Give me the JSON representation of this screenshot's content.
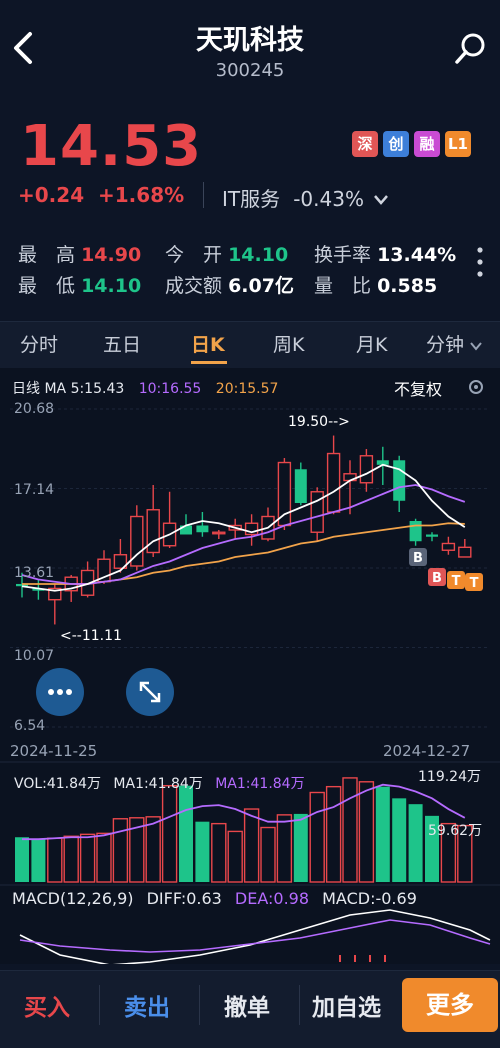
{
  "header": {
    "title": "天玑科技",
    "code": "300245"
  },
  "quote": {
    "price": "14.53",
    "change": "+0.24",
    "change_pct": "+1.68%",
    "sector_name": "IT服务",
    "sector_change": "-0.43%",
    "badges": [
      {
        "label": "深",
        "color": "#e05656"
      },
      {
        "label": "创",
        "color": "#3d7fd9"
      },
      {
        "label": "融",
        "color": "#c94bd3"
      },
      {
        "label": "L1",
        "color": "#f08a2c"
      }
    ]
  },
  "stats": {
    "high_label": "最　高",
    "high": "14.90",
    "open_label": "今　开",
    "open": "14.10",
    "turnover_label": "换手率",
    "turnover": "13.44%",
    "low_label": "最　低",
    "low": "14.10",
    "amount_label": "成交额",
    "amount": "6.07亿",
    "volratio_label": "量　比",
    "volratio": "0.585"
  },
  "tabs": [
    "分时",
    "五日",
    "日K",
    "周K",
    "月K",
    "分钟"
  ],
  "active_tab": "日K",
  "chart_data": {
    "type": "candlestick",
    "legend": {
      "label": "日线 MA",
      "ma5": "5:15.43",
      "ma10": "10:16.55",
      "ma20": "20:15.57"
    },
    "adjust_label": "不复权",
    "y_ticks": [
      "20.68",
      "17.14",
      "13.61",
      "10.07",
      "6.54"
    ],
    "ylim": [
      6.54,
      20.68
    ],
    "start_date": "2024-11-25",
    "end_date": "2024-12-27",
    "annotation_high": "19.50-->",
    "annotation_low": "<--11.11",
    "markers": [
      "B",
      "B",
      "T",
      "T"
    ],
    "candles": [
      {
        "o": 12.9,
        "h": 13.4,
        "l": 12.3,
        "c": 12.8
      },
      {
        "o": 12.7,
        "h": 13.1,
        "l": 12.2,
        "c": 12.6
      },
      {
        "o": 12.2,
        "h": 12.9,
        "l": 11.1,
        "c": 12.7
      },
      {
        "o": 12.6,
        "h": 13.3,
        "l": 12.1,
        "c": 13.2
      },
      {
        "o": 12.4,
        "h": 13.9,
        "l": 12.3,
        "c": 13.5
      },
      {
        "o": 13.0,
        "h": 14.4,
        "l": 12.9,
        "c": 14.0
      },
      {
        "o": 13.6,
        "h": 14.9,
        "l": 13.4,
        "c": 14.2
      },
      {
        "o": 13.7,
        "h": 16.4,
        "l": 13.5,
        "c": 15.9
      },
      {
        "o": 14.3,
        "h": 17.3,
        "l": 14.1,
        "c": 16.2
      },
      {
        "o": 14.6,
        "h": 17.0,
        "l": 14.5,
        "c": 15.6
      },
      {
        "o": 15.5,
        "h": 16.0,
        "l": 15.2,
        "c": 15.1
      },
      {
        "o": 15.5,
        "h": 16.1,
        "l": 15.0,
        "c": 15.2
      },
      {
        "o": 15.2,
        "h": 15.3,
        "l": 14.9,
        "c": 15.2
      },
      {
        "o": 15.3,
        "h": 15.8,
        "l": 14.9,
        "c": 15.5
      },
      {
        "o": 15.1,
        "h": 16.0,
        "l": 14.6,
        "c": 15.6
      },
      {
        "o": 14.9,
        "h": 16.3,
        "l": 14.8,
        "c": 15.9
      },
      {
        "o": 15.5,
        "h": 18.5,
        "l": 15.3,
        "c": 18.3
      },
      {
        "o": 18.0,
        "h": 18.3,
        "l": 16.4,
        "c": 16.5
      },
      {
        "o": 15.2,
        "h": 17.2,
        "l": 14.8,
        "c": 17.0
      },
      {
        "o": 16.1,
        "h": 19.5,
        "l": 16.0,
        "c": 18.7
      },
      {
        "o": 17.5,
        "h": 18.4,
        "l": 16.0,
        "c": 17.8
      },
      {
        "o": 17.4,
        "h": 18.9,
        "l": 17.0,
        "c": 18.6
      },
      {
        "o": 18.4,
        "h": 19.0,
        "l": 17.3,
        "c": 18.2
      },
      {
        "o": 18.4,
        "h": 18.6,
        "l": 16.1,
        "c": 16.6
      },
      {
        "o": 15.7,
        "h": 15.8,
        "l": 14.6,
        "c": 14.8
      },
      {
        "o": 15.1,
        "h": 15.2,
        "l": 14.8,
        "c": 15.0
      },
      {
        "o": 14.4,
        "h": 15.0,
        "l": 14.2,
        "c": 14.7
      },
      {
        "o": 14.1,
        "h": 14.9,
        "l": 14.1,
        "c": 14.53
      }
    ],
    "ma_series": {
      "ma5": [
        12.8,
        12.7,
        12.6,
        12.7,
        12.9,
        13.2,
        13.5,
        14.2,
        14.8,
        15.1,
        15.5,
        15.7,
        15.6,
        15.4,
        15.2,
        15.4,
        16.0,
        16.3,
        16.6,
        17.0,
        17.5,
        17.8,
        18.2,
        18.0,
        17.5,
        16.6,
        15.9,
        15.43
      ],
      "ma10": [
        13.3,
        13.1,
        13.0,
        12.9,
        12.9,
        13.0,
        13.1,
        13.4,
        13.7,
        13.9,
        14.2,
        14.5,
        14.7,
        14.9,
        15.0,
        15.2,
        15.5,
        15.7,
        15.9,
        16.1,
        16.3,
        16.6,
        16.9,
        17.2,
        17.3,
        17.1,
        16.8,
        16.55
      ],
      "ma20": [
        12.9,
        12.9,
        12.9,
        12.9,
        12.9,
        13.0,
        13.1,
        13.2,
        13.4,
        13.5,
        13.7,
        13.8,
        13.9,
        14.1,
        14.2,
        14.3,
        14.5,
        14.7,
        14.8,
        15.0,
        15.1,
        15.2,
        15.3,
        15.4,
        15.5,
        15.5,
        15.6,
        15.57
      ]
    },
    "volume": {
      "label": "VOL:41.84万",
      "ma1": "MA1:41.84万",
      "ma2": "MA1:41.84万",
      "y_max": "119.24万",
      "y_mid": "59.62万",
      "values": [
        46,
        44,
        45,
        47,
        49,
        50,
        65,
        66,
        67,
        99,
        99,
        62,
        60,
        52,
        75,
        56,
        69,
        70,
        92,
        98,
        107,
        103,
        98,
        86,
        80,
        68,
        60,
        58
      ],
      "ma_line": [
        44,
        44,
        45,
        46,
        46,
        48,
        52,
        56,
        60,
        67,
        74,
        78,
        79,
        75,
        68,
        62,
        62,
        64,
        72,
        77,
        86,
        94,
        100,
        98,
        93,
        86,
        75,
        66
      ]
    },
    "macd": {
      "label": "MACD(12,26,9)",
      "diff": "DIFF:0.63",
      "dea": "DEA:0.98",
      "macd": "MACD:-0.69"
    }
  },
  "actions": {
    "buy": "买入",
    "sell": "卖出",
    "cancel": "撤单",
    "watch": "加自选",
    "more": "更多"
  }
}
